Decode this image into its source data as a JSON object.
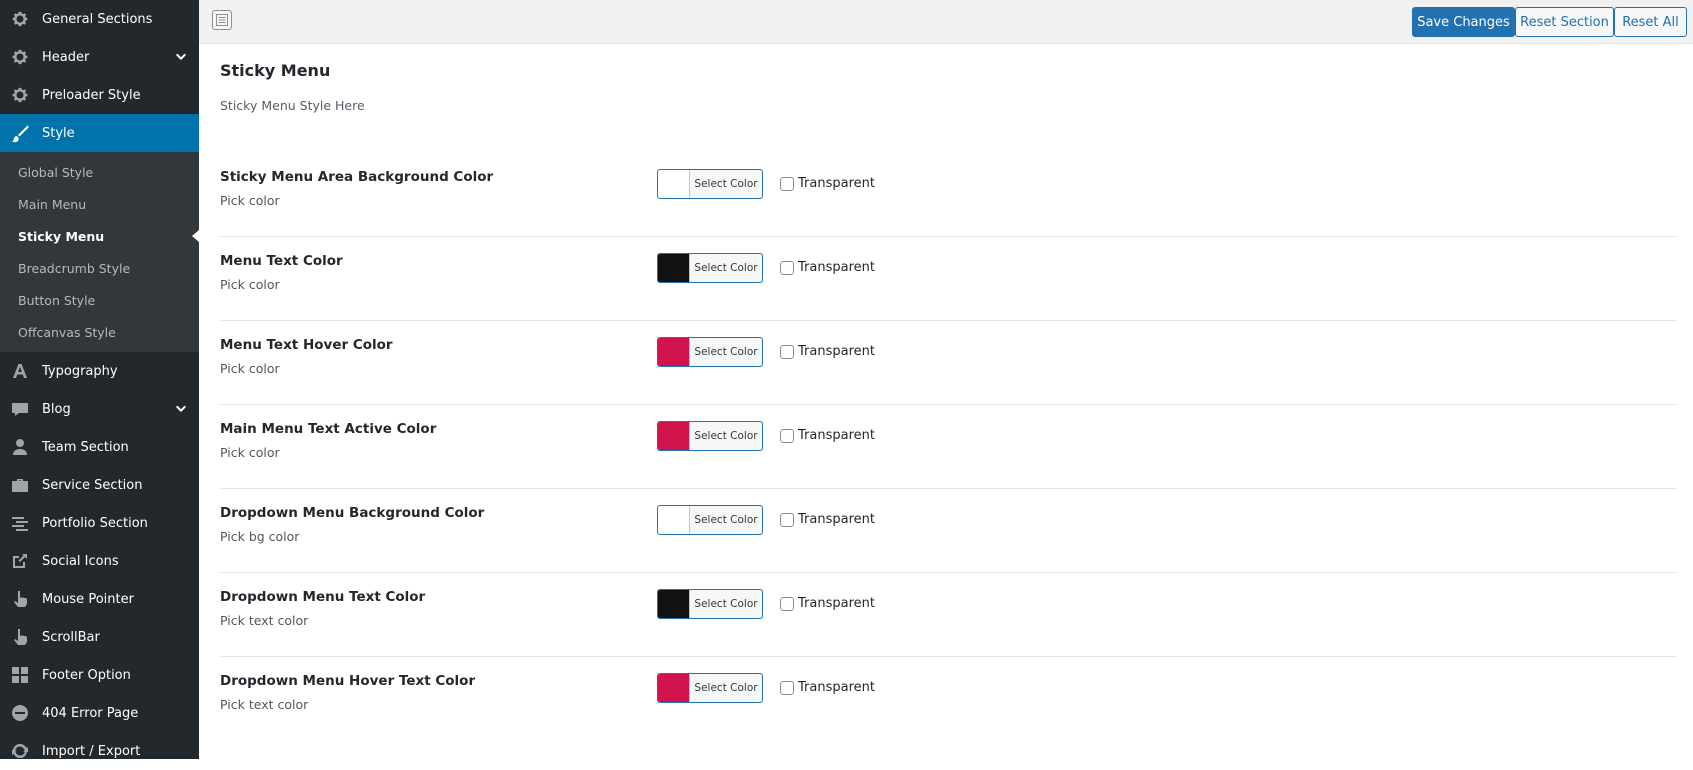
{
  "sidebar": {
    "items": [
      {
        "label": "General Sections",
        "icon": "gear-icon",
        "has_chevron": false
      },
      {
        "label": "Header",
        "icon": "gear-icon",
        "has_chevron": true
      },
      {
        "label": "Preloader Style",
        "icon": "gear-icon",
        "has_chevron": false
      },
      {
        "label": "Style",
        "icon": "brush-icon",
        "has_chevron": false,
        "active": true
      },
      {
        "label": "Typography",
        "icon": "typography-icon",
        "has_chevron": false
      },
      {
        "label": "Blog",
        "icon": "comment-icon",
        "has_chevron": true
      },
      {
        "label": "Team Section",
        "icon": "user-icon",
        "has_chevron": false
      },
      {
        "label": "Service Section",
        "icon": "briefcase-icon",
        "has_chevron": false
      },
      {
        "label": "Portfolio Section",
        "icon": "list-icon",
        "has_chevron": false
      },
      {
        "label": "Social Icons",
        "icon": "share-icon",
        "has_chevron": false
      },
      {
        "label": "Mouse Pointer",
        "icon": "pointer-icon",
        "has_chevron": false
      },
      {
        "label": "ScrollBar",
        "icon": "pointer-icon",
        "has_chevron": false
      },
      {
        "label": "Footer Option",
        "icon": "grid-icon",
        "has_chevron": false
      },
      {
        "label": "404 Error Page",
        "icon": "minus-circle-icon",
        "has_chevron": false
      },
      {
        "label": "Import / Export",
        "icon": "refresh-icon",
        "has_chevron": false
      }
    ],
    "style_submenu": [
      {
        "label": "Global Style"
      },
      {
        "label": "Main Menu"
      },
      {
        "label": "Sticky Menu",
        "current": true
      },
      {
        "label": "Breadcrumb Style"
      },
      {
        "label": "Button Style"
      },
      {
        "label": "Offcanvas Style"
      }
    ]
  },
  "toolbar": {
    "save_label": "Save Changes",
    "reset_section_label": "Reset Section",
    "reset_all_label": "Reset All"
  },
  "section": {
    "title": "Sticky Menu",
    "description": "Sticky Menu Style Here"
  },
  "fields": [
    {
      "title": "Sticky Menu Area Background Color",
      "subtitle": "Pick color",
      "color": "#ffffff",
      "button_label": "Select Color",
      "transparent_label": "Transparent",
      "transparent_checked": false
    },
    {
      "title": "Menu Text Color",
      "subtitle": "Pick color",
      "color": "#111111",
      "button_label": "Select Color",
      "transparent_label": "Transparent",
      "transparent_checked": false
    },
    {
      "title": "Menu Text Hover Color",
      "subtitle": "Pick color",
      "color": "#d0144b",
      "button_label": "Select Color",
      "transparent_label": "Transparent",
      "transparent_checked": false
    },
    {
      "title": "Main Menu Text Active Color",
      "subtitle": "Pick color",
      "color": "#d0144b",
      "button_label": "Select Color",
      "transparent_label": "Transparent",
      "transparent_checked": false
    },
    {
      "title": "Dropdown Menu Background Color",
      "subtitle": "Pick bg color",
      "color": "#ffffff",
      "button_label": "Select Color",
      "transparent_label": "Transparent",
      "transparent_checked": false
    },
    {
      "title": "Dropdown Menu Text Color",
      "subtitle": "Pick text color",
      "color": "#111111",
      "button_label": "Select Color",
      "transparent_label": "Transparent",
      "transparent_checked": false
    },
    {
      "title": "Dropdown Menu Hover Text Color",
      "subtitle": "Pick text color",
      "color": "#d0144b",
      "button_label": "Select Color",
      "transparent_label": "Transparent",
      "transparent_checked": false
    }
  ],
  "colors": {
    "sidebar_bg": "#23282d",
    "submenu_bg": "#32373c",
    "active_bg": "#0073aa",
    "primary_button": "#2271b1"
  }
}
